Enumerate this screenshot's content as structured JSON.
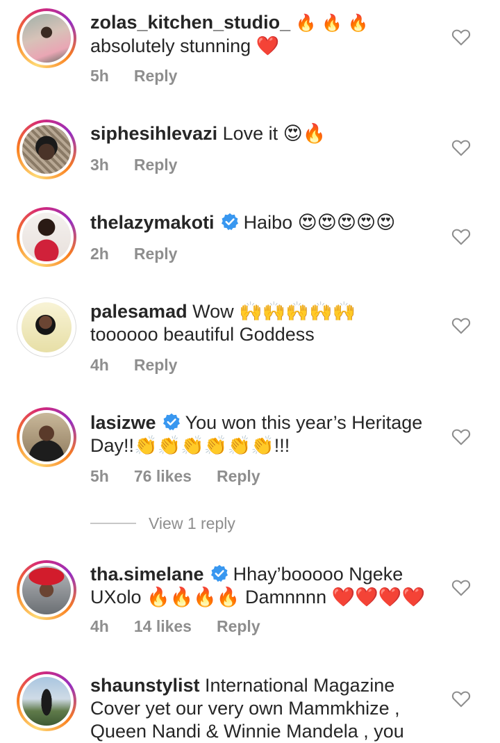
{
  "comments": [
    {
      "username": "zolas_kitchen_studio_",
      "text": "🔥 🔥 🔥",
      "text2": "absolutely stunning ❤️",
      "time": "5h",
      "likes": "",
      "reply": "Reply",
      "verified": false
    },
    {
      "username": "siphesihlevazi",
      "text": " Love it 😍🔥",
      "time": "3h",
      "likes": "",
      "reply": "Reply",
      "verified": false
    },
    {
      "username": "thelazymakoti",
      "text": "Haibo 😍😍😍😍😍",
      "time": "2h",
      "likes": "",
      "reply": "Reply",
      "verified": true
    },
    {
      "username": "palesamad",
      "text": " Wow 🙌🙌🙌🙌🙌",
      "text2": "toooooo beautiful Goddess",
      "time": "4h",
      "likes": "",
      "reply": "Reply",
      "verified": false
    },
    {
      "username": "lasizwe",
      "text": "You won this year’s Heritage",
      "text2": "Day!!👏👏👏👏👏👏!!!",
      "time": "5h",
      "likes": "76 likes",
      "reply": "Reply",
      "verified": true
    },
    {
      "username": "tha.simelane",
      "text": "Hhay’booooo Ngeke",
      "text2": "UXolo 🔥🔥🔥🔥 Damnnnn ❤️❤️❤️❤️",
      "time": "4h",
      "likes": "14 likes",
      "reply": "Reply",
      "verified": true
    },
    {
      "username": "shaunstylist",
      "text": " International Magazine",
      "text2": "Cover yet our very own Mammkhize ,",
      "text3": "Queen Nandi & Winnie Mandela , you",
      "verified": false
    }
  ],
  "view_replies": "View 1 reply"
}
